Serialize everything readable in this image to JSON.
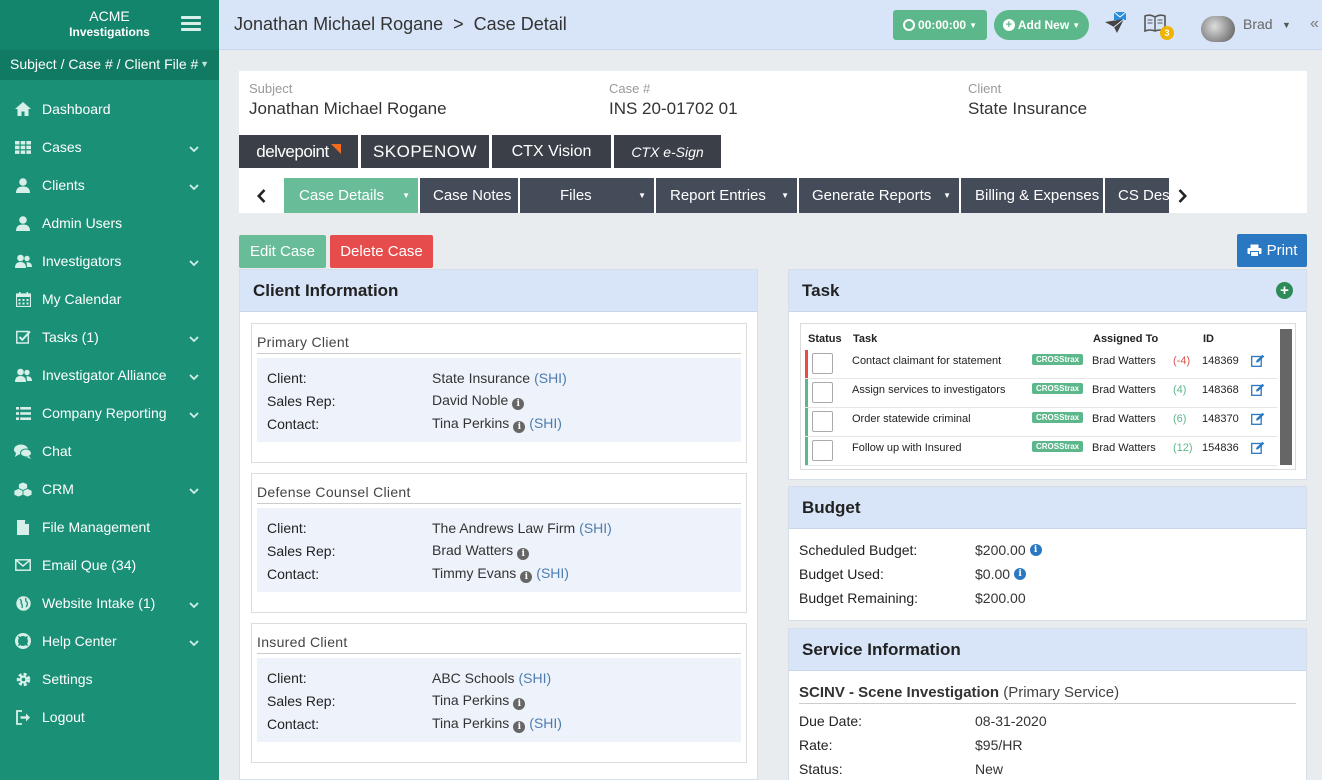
{
  "brand": {
    "line1": "ACME",
    "line2": "Investigations"
  },
  "subject_bar": {
    "label": "Subject / Case # / Client File #"
  },
  "nav": [
    {
      "label": "Dashboard",
      "icon": "home-icon",
      "chevron": false
    },
    {
      "label": "Cases",
      "icon": "grid-icon",
      "chevron": true
    },
    {
      "label": "Clients",
      "icon": "user-icon",
      "chevron": true
    },
    {
      "label": "Admin Users",
      "icon": "user-icon",
      "chevron": false
    },
    {
      "label": "Investigators",
      "icon": "users-icon",
      "chevron": true
    },
    {
      "label": "My Calendar",
      "icon": "calendar-icon",
      "chevron": false
    },
    {
      "label": "Tasks (1)",
      "icon": "checkbox-icon",
      "chevron": true
    },
    {
      "label": "Investigator Alliance",
      "icon": "users-icon",
      "chevron": true
    },
    {
      "label": "Company Reporting",
      "icon": "list-icon",
      "chevron": true
    },
    {
      "label": "Chat",
      "icon": "chat-icon",
      "chevron": false
    },
    {
      "label": "CRM",
      "icon": "cubes-icon",
      "chevron": true
    },
    {
      "label": "File Management",
      "icon": "file-icon",
      "chevron": false
    },
    {
      "label": "Email Que (34)",
      "icon": "envelope-icon",
      "chevron": false
    },
    {
      "label": "Website Intake (1)",
      "icon": "globe-icon",
      "chevron": true
    },
    {
      "label": "Help Center",
      "icon": "lifebuoy-icon",
      "chevron": true
    },
    {
      "label": "Settings",
      "icon": "gear-icon",
      "chevron": false
    },
    {
      "label": "Logout",
      "icon": "logout-icon",
      "chevron": false
    }
  ],
  "breadcrumb": {
    "subject": "Jonathan Michael Rogane",
    "separator": ">",
    "page": "Case Detail"
  },
  "topbar": {
    "timer": "00:00:00",
    "add_new": "Add New",
    "notification_count": "3",
    "user_name": "Brad"
  },
  "case": {
    "subject_label": "Subject",
    "subject": "Jonathan Michael Rogane",
    "case_label": "Case #",
    "case_number": "INS 20-01702 01",
    "client_label": "Client",
    "client": "State Insurance"
  },
  "integrations": [
    "delvepoint",
    "SKOPENOW",
    "CTX Vision",
    "CTX e-Sign"
  ],
  "tabs": [
    {
      "label": "Case Details",
      "active": true,
      "dropdown": true
    },
    {
      "label": "Case Notes",
      "active": false,
      "dropdown": false
    },
    {
      "label": "Files",
      "active": false,
      "dropdown": true
    },
    {
      "label": "Report Entries",
      "active": false,
      "dropdown": true
    },
    {
      "label": "Generate Reports",
      "active": false,
      "dropdown": true
    },
    {
      "label": "Billing & Expenses",
      "active": false,
      "dropdown": false
    },
    {
      "label": "CS Desk",
      "active": false,
      "dropdown": false
    }
  ],
  "actions": {
    "edit": "Edit Case",
    "delete": "Delete Case",
    "print": "Print"
  },
  "client_info": {
    "title": "Client Information",
    "labels": {
      "client": "Client:",
      "sales_rep": "Sales Rep:",
      "contact": "Contact:"
    },
    "groups": [
      {
        "title": "Primary Client",
        "client": "State Insurance",
        "client_tag": "(SHI)",
        "sales_rep": "David Noble",
        "contact": "Tina Perkins",
        "contact_tag": "(SHI)"
      },
      {
        "title": "Defense Counsel Client",
        "client": "The Andrews Law Firm",
        "client_tag": "(SHI)",
        "sales_rep": "Brad Watters",
        "contact": "Timmy Evans",
        "contact_tag": "(SHI)"
      },
      {
        "title": "Insured Client",
        "client": "ABC Schools",
        "client_tag": "(SHI)",
        "sales_rep": "Tina Perkins",
        "contact": "Tina Perkins",
        "contact_tag": "(SHI)"
      }
    ]
  },
  "task": {
    "title": "Task",
    "columns": {
      "status": "Status",
      "task": "Task",
      "assigned": "Assigned To",
      "id": "ID"
    },
    "rows": [
      {
        "task": "Contact claimant for statement",
        "tag": "CROSStrax",
        "assigned": "Brad Watters",
        "count": "(-4)",
        "id": "148369",
        "bar_color": "#e74c4c",
        "count_color": "#d9534f"
      },
      {
        "task": "Assign services to investigators",
        "tag": "CROSStrax",
        "assigned": "Brad Watters",
        "count": "(4)",
        "id": "148368",
        "bar_color": "#5cb88a",
        "count_color": "#5cb88a"
      },
      {
        "task": "Order statewide criminal",
        "tag": "CROSStrax",
        "assigned": "Brad Watters",
        "count": "(6)",
        "id": "148370",
        "bar_color": "#5cb88a",
        "count_color": "#5cb88a"
      },
      {
        "task": "Follow up with Insured",
        "tag": "CROSStrax",
        "assigned": "Brad Watters",
        "count": "(12)",
        "id": "154836",
        "bar_color": "#5cb88a",
        "count_color": "#5cb88a"
      }
    ]
  },
  "budget": {
    "title": "Budget",
    "rows": [
      {
        "label": "Scheduled Budget:",
        "value": "$200.00",
        "info": true
      },
      {
        "label": "Budget Used:",
        "value": "$0.00",
        "info": true
      },
      {
        "label": "Budget Remaining:",
        "value": "$200.00",
        "info": false
      }
    ]
  },
  "service": {
    "title": "Service Information",
    "service_name": "SCINV - Scene Investigation",
    "service_type": "(Primary Service)",
    "rows": [
      {
        "label": "Due Date:",
        "value": "08-31-2020"
      },
      {
        "label": "Rate:",
        "value": "$95/HR"
      },
      {
        "label": "Status:",
        "value": "New"
      }
    ]
  },
  "colors": {
    "sidebar": "#1a9077",
    "accent_green": "#5cb88a",
    "danger": "#e74c4c",
    "primary": "#2b78c2",
    "header_blue": "#d8e5f8"
  }
}
